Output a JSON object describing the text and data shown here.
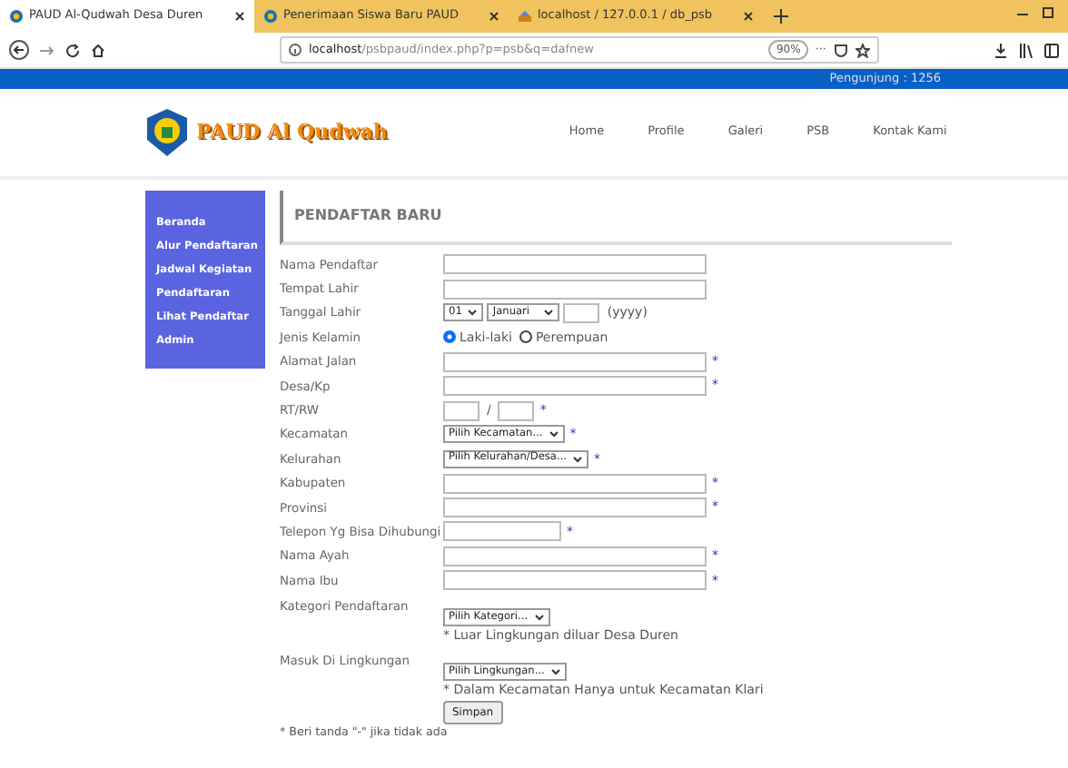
{
  "browser": {
    "tabs": [
      {
        "title": "PAUD Al-Qudwah Desa Duren",
        "selected": true
      },
      {
        "title": "Penerimaan Siswa Baru PAUD",
        "selected": false
      },
      {
        "title": "localhost / 127.0.0.1 / db_psb",
        "selected": false
      }
    ],
    "url_host": "localhost",
    "url_path": "/psbpaud/index.php?p=psb&q=dafnew",
    "zoom": "90%",
    "more": "···"
  },
  "topbar": {
    "visitors": "Pengunjung : 1256"
  },
  "site": {
    "title": "PAUD Al Qudwah",
    "nav": [
      "Home",
      "Profile",
      "Galeri",
      "PSB",
      "Kontak Kami"
    ]
  },
  "sidebar": {
    "items": [
      "Beranda",
      "Alur Pendaftaran",
      "Jadwal Kegiatan",
      "Pendaftaran",
      "Lihat Pendaftar",
      "Admin"
    ]
  },
  "form": {
    "heading": "PENDAFTAR BARU",
    "fields": [
      {
        "kind": "text",
        "label": "Nama Pendaftar"
      },
      {
        "kind": "text",
        "label": "Tempat Lahir"
      },
      {
        "kind": "date",
        "label": "Tanggal Lahir",
        "day": "01",
        "month": "Januari",
        "year_hint": "(yyyy)"
      },
      {
        "kind": "radio",
        "label": "Jenis Kelamin",
        "options": [
          {
            "label": "Laki-laki",
            "selected": true
          },
          {
            "label": "Perempuan",
            "selected": false
          }
        ]
      },
      {
        "kind": "text",
        "label": "Alamat Jalan",
        "mark": "*"
      },
      {
        "kind": "text",
        "label": "Desa/Kp",
        "mark": "*"
      },
      {
        "kind": "rtrw",
        "label": "RT/RW",
        "separator": "/",
        "mark": "*"
      },
      {
        "kind": "select",
        "label": "Kecamatan",
        "value": "Pilih Kecamatan...",
        "mark": "*"
      },
      {
        "kind": "select",
        "label": "Kelurahan",
        "value": "Pilih Kelurahan/Desa...",
        "mark": "*"
      },
      {
        "kind": "text",
        "label": "Kabupaten",
        "mark": "*"
      },
      {
        "kind": "text",
        "label": "Provinsi",
        "mark": "*"
      },
      {
        "kind": "short",
        "label": "Telepon Yg Bisa Dihubungi",
        "mark": "*"
      },
      {
        "kind": "text",
        "label": "Nama Ayah",
        "mark": "*"
      },
      {
        "kind": "text",
        "label": "Nama Ibu",
        "mark": "*"
      },
      {
        "kind": "select_note",
        "label": "Kategori Pendaftaran",
        "value": "Pilih Kategori...",
        "note": "* Luar Lingkungan diluar Desa Duren"
      },
      {
        "kind": "select_note",
        "label": "Masuk Di Lingkungan",
        "value": "Pilih Lingkungan...",
        "note": "* Dalam Kecamatan Hanya untuk Kecamatan Klari"
      }
    ],
    "submit": "Simpan",
    "footnote": "* Beri tanda \"-\" jika tidak ada"
  }
}
